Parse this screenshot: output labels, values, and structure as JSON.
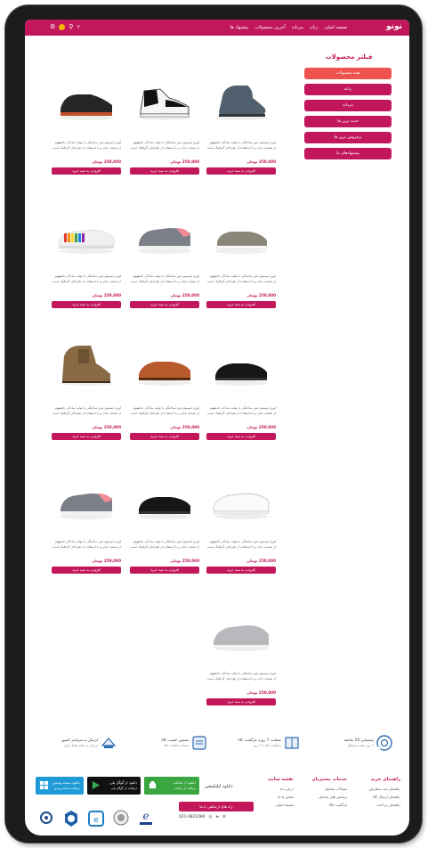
{
  "header": {
    "logo": "نونو",
    "nav": [
      "صفحه اصلی",
      "زنانه",
      "مردانه",
      "آخرین محصولات",
      "پیشنهاد ها"
    ],
    "brand_color": "#c2185b"
  },
  "filter": {
    "title": "فیلتر محصولات",
    "items": [
      "همه محصولات",
      "زنانه",
      "مردانه",
      "جدید ترین ها",
      "پرفروش ترین ها",
      "پیشنهادهای ما"
    ],
    "active_index": 0
  },
  "products": [
    {
      "desc": "لورم ایپسوم متن ساختگی با تولید سادگی نامفهوم از صنعت چاپ و با استفاده از طراحان گرافیک است",
      "price": "250,000 تومان",
      "button": "افزودن به سبد خرید",
      "shoe": "boot-gray"
    },
    {
      "desc": "لورم ایپسوم متن ساختگی با تولید سادگی نامفهوم از صنعت چاپ و با استفاده از طراحان گرافیک است",
      "price": "250,000 تومان",
      "button": "افزودن به سبد خرید",
      "shoe": "sneaker-jordan"
    },
    {
      "desc": "لورم ایپسوم متن ساختگی با تولید سادگی نامفهوم از صنعت چاپ و با استفاده از طراحان گرافیک است",
      "price": "250,000 تومان",
      "button": "افزودن به سبد خرید",
      "shoe": "runner-black"
    },
    {
      "desc": "لورم ایپسوم متن ساختگی با تولید سادگی نامفهوم از صنعت چاپ و با استفاده از طراحان گرافیک است",
      "price": "250,000 تومان",
      "button": "افزودن به سبد خرید",
      "shoe": "loafer-gray"
    },
    {
      "desc": "لورم ایپسوم متن ساختگی با تولید سادگی نامفهوم از صنعت چاپ و با استفاده از طراحان گرافیک است",
      "price": "250,000 تومان",
      "button": "افزودن به سبد خرید",
      "shoe": "sneaker-pink"
    },
    {
      "desc": "لورم ایپسوم متن ساختگی با تولید سادگی نامفهوم از صنعت چاپ و با استفاده از طراحان گرافیک است",
      "price": "250,000 تومان",
      "button": "افزودن به سبد خرید",
      "shoe": "sneaker-rainbow"
    },
    {
      "desc": "لورم ایپسوم متن ساختگی با تولید سادگی نامفهوم از صنعت چاپ و با استفاده از طراحان گرافیک است",
      "price": "250,000 تومان",
      "button": "افزودن به سبد خرید",
      "shoe": "dress-black"
    },
    {
      "desc": "لورم ایپسوم متن ساختگی با تولید سادگی نامفهوم از صنعت چاپ و با استفاده از طراحان گرافیک است",
      "price": "250,000 تومان",
      "button": "افزودن به سبد خرید",
      "shoe": "oxford-brown"
    },
    {
      "desc": "لورم ایپسوم متن ساختگی با تولید سادگی نامفهوم از صنعت چاپ و با استفاده از طراحان گرافیک است",
      "price": "250,000 تومان",
      "button": "افزودن به سبد خرید",
      "shoe": "boot-tan"
    },
    {
      "desc": "لورم ایپسوم متن ساختگی با تولید سادگی نامفهوم از صنعت چاپ و با استفاده از طراحان گرافیک است",
      "price": "250,000 تومان",
      "button": "افزودن به سبد خرید",
      "shoe": "sneaker-white"
    },
    {
      "desc": "لورم ایپسوم متن ساختگی با تولید سادگی نامفهوم از صنعت چاپ و با استفاده از طراحان گرافیک است",
      "price": "250,000 تومان",
      "button": "افزودن به سبد خرید",
      "shoe": "dress-black"
    },
    {
      "desc": "لورم ایپسوم متن ساختگی با تولید سادگی نامفهوم از صنعت چاپ و با استفاده از طراحان گرافیک است",
      "price": "250,000 تومان",
      "button": "افزودن به سبد خرید",
      "shoe": "sneaker-pink"
    },
    {
      "desc": "لورم ایپسوم متن ساختگی با تولید سادگی نامفهوم از صنعت چاپ و با استفاده از طراحان گرافیک است",
      "price": "250,000 تومان",
      "button": "افزودن به سبد خرید",
      "shoe": "sneaker-lightgray"
    }
  ],
  "features": [
    {
      "title": "پشتیبانی 24 ساعته",
      "sub": "7 روز هفته پاسخگو",
      "icon": "support-icon"
    },
    {
      "title": "ضمانت 7 روزه بازگشت کالا",
      "sub": "بازگشت کالا تا 7 روز",
      "icon": "return-icon"
    },
    {
      "title": "تضمین کیفیت کالا",
      "sub": "ضمانت اصالت کالا",
      "icon": "quality-icon"
    },
    {
      "title": "ارسال به سراسر کشور",
      "sub": "ارسال به تمام نقاط ایران",
      "icon": "delivery-icon"
    }
  ],
  "footer": {
    "col1": {
      "title": "راهنمای خرید",
      "items": [
        "راهنمای ثبت سفارش",
        "راهنمای ارسال کالا",
        "راهنمای پرداخت"
      ]
    },
    "col2": {
      "title": "خدمات مشتریان",
      "items": [
        "سوالات متداول",
        "پرسش های متداول",
        "بازگشت کالا"
      ]
    },
    "col3": {
      "title": "نقشه سایت",
      "items": [
        "درباره ما",
        "تماس با ما",
        "صفحه اصلی"
      ]
    },
    "app_label": "دانلود اپلیکیشن",
    "apps": [
      {
        "title": "دانلود از مایکت",
        "sub": "دریافت از مایکت",
        "color": "#3aa640",
        "icon": "android-icon"
      },
      {
        "title": "دانلود از گوگل پلی",
        "sub": "دریافت از گوگل پلی",
        "color": "#111111",
        "icon": "play-icon"
      },
      {
        "title": "دانلود نسخه ویندوز",
        "sub": "دریافت نسخه ویندوز",
        "color": "#1e9bd7",
        "icon": "windows-icon"
      }
    ],
    "social_button": "راه های ارتباطی با ما",
    "phone": "021-0821080",
    "badges": [
      "enamad-badge",
      "samandehi-badge",
      "ecommerce-badge",
      "union-badge",
      "trust-badge"
    ]
  }
}
